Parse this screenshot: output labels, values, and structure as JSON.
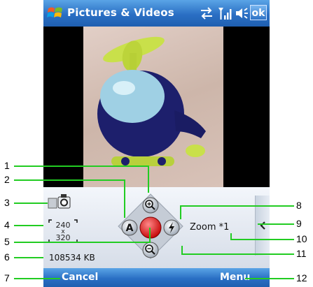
{
  "titlebar": {
    "title": "Pictures & Videos",
    "ok_label": "ok"
  },
  "icons": {
    "start": "windows-flag-icon",
    "connectivity": "connection-arrows-icon",
    "signal": "signal-strength-icon",
    "volume": "speaker-icon"
  },
  "controls": {
    "resolution_width": "240",
    "resolution_x": "x",
    "resolution_height": "320",
    "memory": "108534 KB",
    "zoom_label": "Zoom",
    "zoom_value": "*1"
  },
  "softkeys": {
    "left": "Cancel",
    "right": "Menu"
  },
  "callouts": [
    "1",
    "2",
    "3",
    "4",
    "5",
    "6",
    "7",
    "8",
    "9",
    "10",
    "11",
    "12"
  ],
  "colors": {
    "accent": "#2a6fc4",
    "callout_line": "#22cc22",
    "capture": "#e21b1b"
  }
}
